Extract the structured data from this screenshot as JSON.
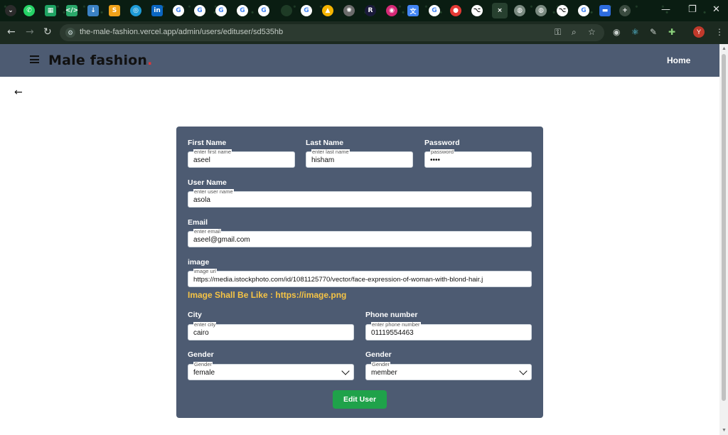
{
  "browser": {
    "url": "the-male-fashion.vercel.app/admin/users/edituser/sd535hb",
    "profile_initial": "Y",
    "tabs": [
      {
        "icon": "chevron-down-icon",
        "glyph": "⌄",
        "color": "#2b2b2b"
      },
      {
        "icon": "whatsapp-icon",
        "glyph": "✆",
        "color": "#25d366"
      },
      {
        "icon": "sheets-icon",
        "glyph": "▦",
        "color": "#1fa463"
      },
      {
        "icon": "code-icon",
        "glyph": "</>",
        "color": "#2aa86a"
      },
      {
        "icon": "download-icon",
        "glyph": "↓",
        "color": "#3b82c4"
      },
      {
        "icon": "s-icon",
        "glyph": "S",
        "color": "#f0a21a"
      },
      {
        "icon": "target-icon",
        "glyph": "◎",
        "color": "#1e9bd7"
      },
      {
        "icon": "linkedin-icon",
        "glyph": "in",
        "color": "#0a66c2"
      },
      {
        "icon": "google-icon",
        "glyph": "G",
        "color": "#4285f4"
      },
      {
        "icon": "google-icon",
        "glyph": "G",
        "color": "#4285f4"
      },
      {
        "icon": "google-icon",
        "glyph": "G",
        "color": "#4285f4"
      },
      {
        "icon": "google-icon",
        "glyph": "G",
        "color": "#4285f4"
      },
      {
        "icon": "google-icon",
        "glyph": "G",
        "color": "#4285f4"
      },
      {
        "icon": "blank-tab-icon",
        "glyph": "",
        "color": "#1e3b26"
      },
      {
        "icon": "google-icon",
        "glyph": "G",
        "color": "#4285f4"
      },
      {
        "icon": "drive-icon",
        "glyph": "▲",
        "color": "#f4b400"
      },
      {
        "icon": "ai-icon",
        "glyph": "✺",
        "color": "#6b6b6b"
      },
      {
        "icon": "r-icon",
        "glyph": "R",
        "color": "#1a1a3a"
      },
      {
        "icon": "instagram-icon",
        "glyph": "◉",
        "color": "#d62976"
      },
      {
        "icon": "translate-icon",
        "glyph": "文",
        "color": "#4285f4"
      },
      {
        "icon": "google-icon",
        "glyph": "G",
        "color": "#4285f4"
      },
      {
        "icon": "record-icon",
        "glyph": "●",
        "color": "#e53935"
      },
      {
        "icon": "github-icon",
        "glyph": "⌥",
        "color": "#111111"
      },
      {
        "icon": "close-tab-icon",
        "glyph": "×",
        "color": "#27402f"
      },
      {
        "icon": "globe-icon",
        "glyph": "◍",
        "color": "#7a8a80"
      },
      {
        "icon": "globe-icon",
        "glyph": "◍",
        "color": "#7a8a80"
      },
      {
        "icon": "github-icon",
        "glyph": "⌥",
        "color": "#111111"
      },
      {
        "icon": "google-icon",
        "glyph": "G",
        "color": "#4285f4"
      },
      {
        "icon": "minus-tab-icon",
        "glyph": "▬",
        "color": "#2d6cdf"
      },
      {
        "icon": "new-tab-icon",
        "glyph": "+",
        "color": "#3a4b3f"
      }
    ]
  },
  "header": {
    "logo_text": "Male fashion",
    "logo_dot": ".",
    "nav_home": "Home"
  },
  "form": {
    "first_name": {
      "label": "First Name",
      "placeholder": "enter first name",
      "value": "aseel"
    },
    "last_name": {
      "label": "Last Name",
      "placeholder": "enter last name",
      "value": "hisham"
    },
    "password": {
      "label": "Password",
      "placeholder": "password",
      "value": "••••"
    },
    "username": {
      "label": "User Name",
      "placeholder": "enter user name",
      "value": "asola"
    },
    "email": {
      "label": "Email",
      "placeholder": "enter email",
      "value": "aseel@gmail.com"
    },
    "image": {
      "label": "image",
      "placeholder": "image url",
      "value": "https://media.istockphoto.com/id/1081125770/vector/face-expression-of-woman-with-blond-hair.j"
    },
    "image_hint": "Image Shall Be Like : https://image.png",
    "city": {
      "label": "City",
      "placeholder": "enter city",
      "value": "cairo"
    },
    "phone": {
      "label": "Phone number",
      "placeholder": "enter phone number",
      "value": "01119554463"
    },
    "gender": {
      "label": "Gender",
      "placeholder": "Gender",
      "value": "female"
    },
    "role": {
      "label": "Gender",
      "placeholder": "Gender",
      "value": "member"
    },
    "submit_label": "Edit User"
  },
  "colors": {
    "header_bg": "#4d5b72",
    "card_bg": "#4d5b72",
    "logo_dot": "#e53637",
    "hint": "#f6c445",
    "button": "#1fa24a"
  }
}
